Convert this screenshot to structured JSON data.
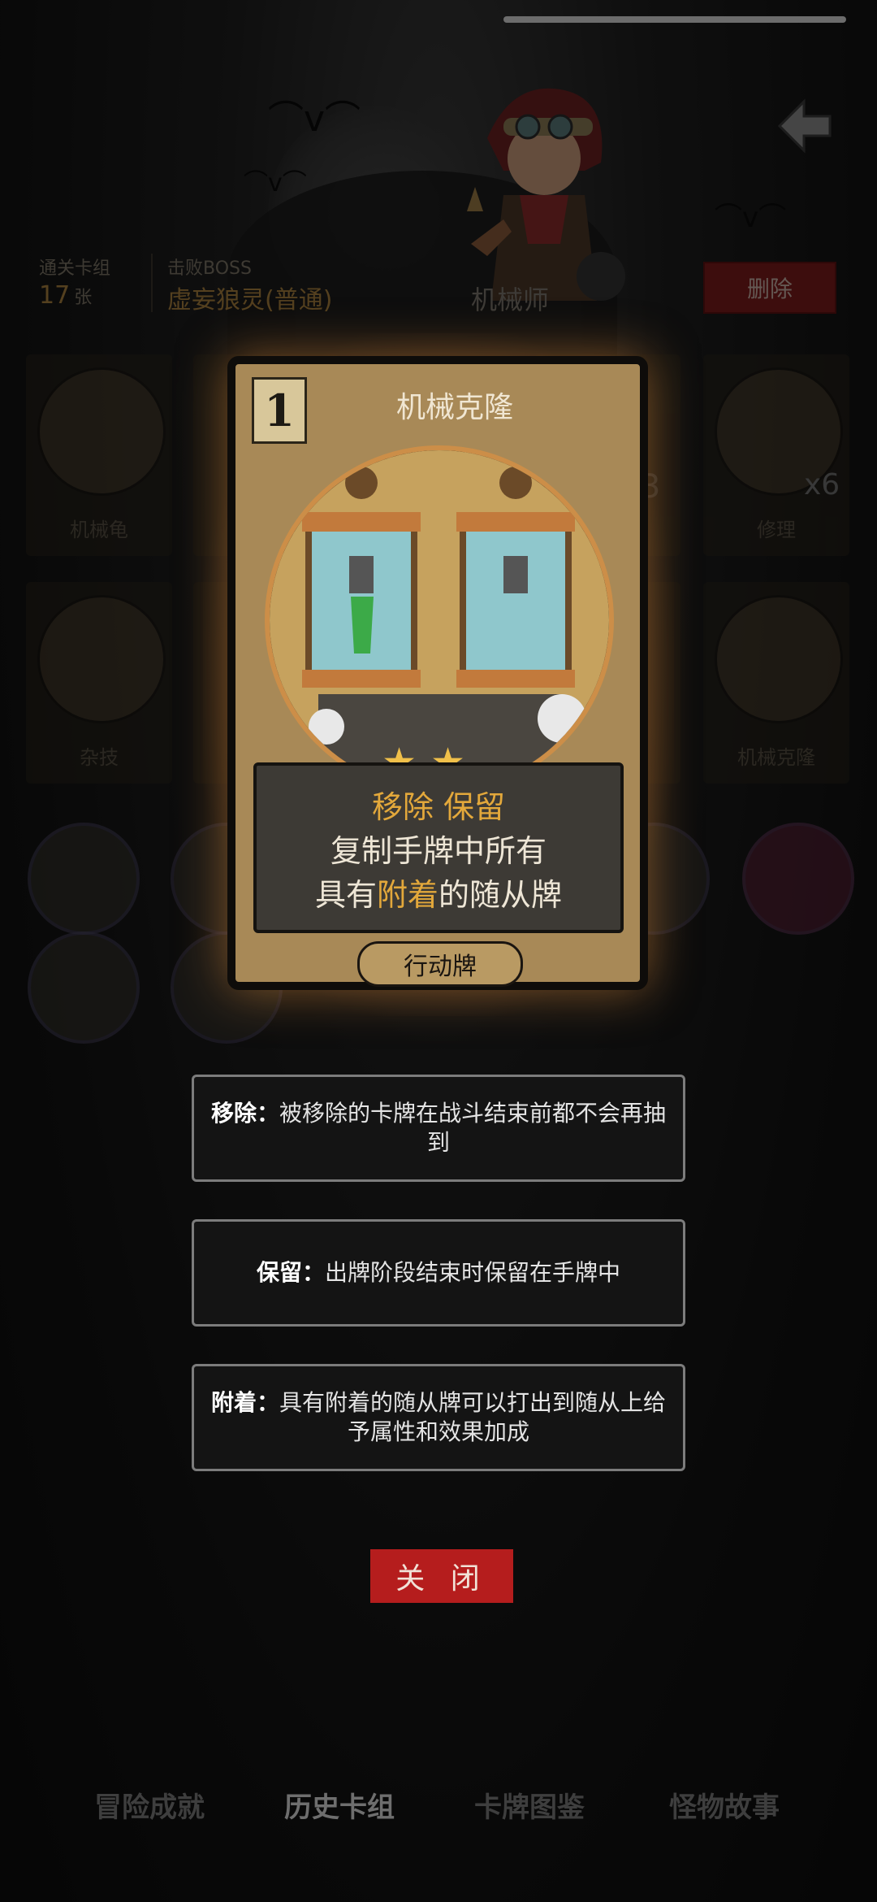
{
  "header": {
    "clear_deck_label": "通关卡组",
    "deck_count": "17",
    "deck_unit": "张",
    "boss_label": "击败BOSS",
    "boss_name": "虚妄狼灵(普通)",
    "class_name": "机械师",
    "delete_label": "删除"
  },
  "grid_cards": [
    {
      "label": "机械龟"
    },
    {
      "label": "修理",
      "badge": "x6"
    },
    {
      "label": "杂技"
    },
    {
      "label": "机械克隆"
    }
  ],
  "card": {
    "cost": "1",
    "title": "机械克隆",
    "stars": 2,
    "keywords_line": [
      "移除",
      "保留"
    ],
    "desc_line2": "复制手牌中所有",
    "desc_line3_pre": "具有",
    "desc_line3_hl": "附着",
    "desc_line3_post": "的随从牌",
    "type": "行动牌"
  },
  "keywords": [
    {
      "term": "移除：",
      "text": "被移除的卡牌在战斗结束前都不会再抽到"
    },
    {
      "term": "保留：",
      "text": "出牌阶段结束时保留在手牌中"
    },
    {
      "term": "附着：",
      "text": "具有附着的随从牌可以打出到随从上给予属性和效果加成"
    }
  ],
  "close_label": "关 闭",
  "tabs": [
    "冒险成就",
    "历史卡组",
    "卡牌图鉴",
    "怪物故事"
  ],
  "partial_number": "3",
  "colors": {
    "accent_gold": "#e3a83b",
    "delete_red": "#7a1a1a",
    "close_red": "#b51d1d"
  }
}
